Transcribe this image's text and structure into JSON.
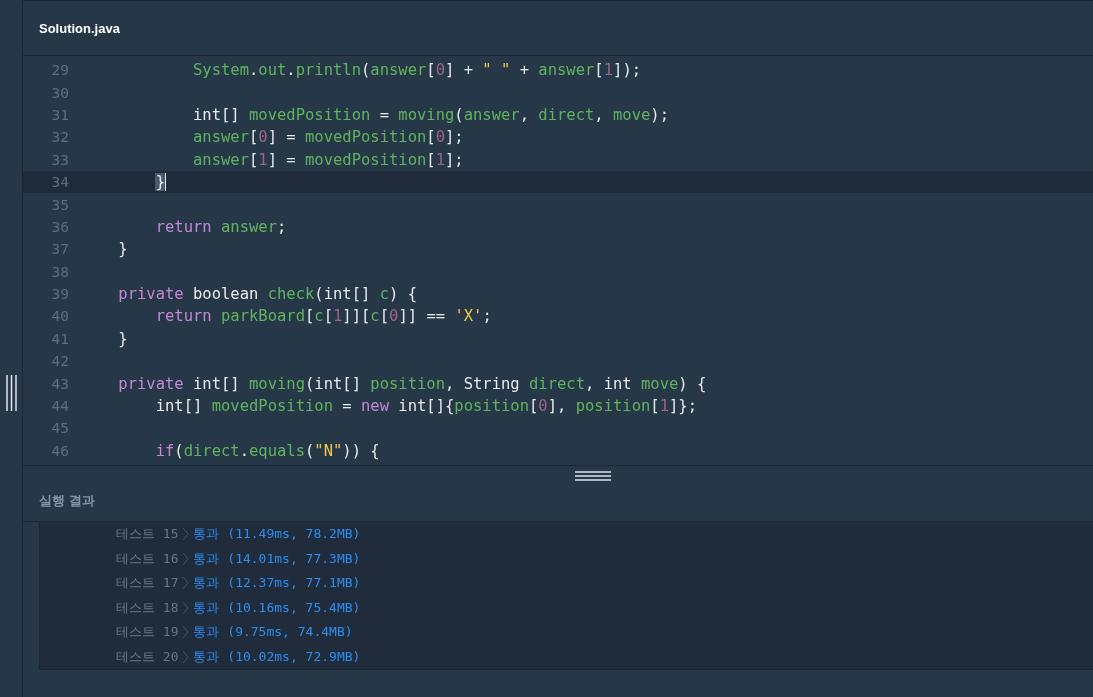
{
  "editor": {
    "file_tab": "Solution.java",
    "lines": [
      {
        "number": "29",
        "current": false,
        "tokens": [
          {
            "kind": "variable",
            "text": "            System"
          },
          {
            "kind": "plain",
            "text": "."
          },
          {
            "kind": "variable",
            "text": "out"
          },
          {
            "kind": "plain",
            "text": "."
          },
          {
            "kind": "variable",
            "text": "println"
          },
          {
            "kind": "plain",
            "text": "("
          },
          {
            "kind": "variable",
            "text": "answer"
          },
          {
            "kind": "plain",
            "text": "["
          },
          {
            "kind": "number",
            "text": "0"
          },
          {
            "kind": "plain",
            "text": "] + "
          },
          {
            "kind": "string",
            "text": "\" \""
          },
          {
            "kind": "plain",
            "text": " + "
          },
          {
            "kind": "variable",
            "text": "answer"
          },
          {
            "kind": "plain",
            "text": "["
          },
          {
            "kind": "number",
            "text": "1"
          },
          {
            "kind": "plain",
            "text": "]);"
          }
        ]
      },
      {
        "number": "30",
        "current": false
      },
      {
        "number": "31",
        "current": false,
        "tokens": [
          {
            "kind": "plain",
            "text": "            int[] "
          },
          {
            "kind": "variable",
            "text": "movedPosition"
          },
          {
            "kind": "plain",
            "text": " = "
          },
          {
            "kind": "variable",
            "text": "moving"
          },
          {
            "kind": "plain",
            "text": "("
          },
          {
            "kind": "variable",
            "text": "answer"
          },
          {
            "kind": "plain",
            "text": ", "
          },
          {
            "kind": "variable",
            "text": "direct"
          },
          {
            "kind": "plain",
            "text": ", "
          },
          {
            "kind": "variable",
            "text": "move"
          },
          {
            "kind": "plain",
            "text": ");"
          }
        ]
      },
      {
        "number": "32",
        "current": false,
        "tokens": [
          {
            "kind": "variable",
            "text": "            answer"
          },
          {
            "kind": "plain",
            "text": "["
          },
          {
            "kind": "number",
            "text": "0"
          },
          {
            "kind": "plain",
            "text": "] = "
          },
          {
            "kind": "variable",
            "text": "movedPosition"
          },
          {
            "kind": "plain",
            "text": "["
          },
          {
            "kind": "number",
            "text": "0"
          },
          {
            "kind": "plain",
            "text": "];"
          }
        ]
      },
      {
        "number": "33",
        "current": false,
        "tokens": [
          {
            "kind": "variable",
            "text": "            answer"
          },
          {
            "kind": "plain",
            "text": "["
          },
          {
            "kind": "number",
            "text": "1"
          },
          {
            "kind": "plain",
            "text": "] = "
          },
          {
            "kind": "variable",
            "text": "movedPosition"
          },
          {
            "kind": "plain",
            "text": "["
          },
          {
            "kind": "number",
            "text": "1"
          },
          {
            "kind": "plain",
            "text": "];"
          }
        ]
      },
      {
        "number": "34",
        "current": true,
        "tokens": [
          {
            "kind": "match",
            "text": "        }"
          }
        ]
      },
      {
        "number": "35",
        "current": false
      },
      {
        "number": "36",
        "current": false,
        "tokens": [
          {
            "kind": "keyword",
            "text": "        return "
          },
          {
            "kind": "variable",
            "text": "answer"
          },
          {
            "kind": "plain",
            "text": ";"
          }
        ]
      },
      {
        "number": "37",
        "current": false,
        "tokens": [
          {
            "kind": "plain",
            "text": "    }"
          }
        ]
      },
      {
        "number": "38",
        "current": false
      },
      {
        "number": "39",
        "current": false,
        "tokens": [
          {
            "kind": "keyword",
            "text": "    private"
          },
          {
            "kind": "plain",
            "text": " boolean "
          },
          {
            "kind": "variable",
            "text": "check"
          },
          {
            "kind": "plain",
            "text": "(int[] "
          },
          {
            "kind": "variable",
            "text": "c"
          },
          {
            "kind": "plain",
            "text": ") {"
          }
        ]
      },
      {
        "number": "40",
        "current": false,
        "tokens": [
          {
            "kind": "keyword",
            "text": "        return "
          },
          {
            "kind": "variable",
            "text": "parkBoard"
          },
          {
            "kind": "plain",
            "text": "["
          },
          {
            "kind": "variable",
            "text": "c"
          },
          {
            "kind": "plain",
            "text": "["
          },
          {
            "kind": "number",
            "text": "1"
          },
          {
            "kind": "plain",
            "text": "]]["
          },
          {
            "kind": "variable",
            "text": "c"
          },
          {
            "kind": "plain",
            "text": "["
          },
          {
            "kind": "number",
            "text": "0"
          },
          {
            "kind": "plain",
            "text": "]] == "
          },
          {
            "kind": "string",
            "text": "'X'"
          },
          {
            "kind": "plain",
            "text": ";"
          }
        ]
      },
      {
        "number": "41",
        "current": false,
        "tokens": [
          {
            "kind": "plain",
            "text": "    }"
          }
        ]
      },
      {
        "number": "42",
        "current": false
      },
      {
        "number": "43",
        "current": false,
        "tokens": [
          {
            "kind": "keyword",
            "text": "    private"
          },
          {
            "kind": "plain",
            "text": " int[] "
          },
          {
            "kind": "variable",
            "text": "moving"
          },
          {
            "kind": "plain",
            "text": "(int[] "
          },
          {
            "kind": "variable",
            "text": "position"
          },
          {
            "kind": "plain",
            "text": ", String "
          },
          {
            "kind": "variable",
            "text": "direct"
          },
          {
            "kind": "plain",
            "text": ", int "
          },
          {
            "kind": "variable",
            "text": "move"
          },
          {
            "kind": "plain",
            "text": ") {"
          }
        ]
      },
      {
        "number": "44",
        "current": false,
        "tokens": [
          {
            "kind": "plain",
            "text": "        int[] "
          },
          {
            "kind": "variable",
            "text": "movedPosition"
          },
          {
            "kind": "plain",
            "text": " = "
          },
          {
            "kind": "keyword",
            "text": "new"
          },
          {
            "kind": "plain",
            "text": " int[]{"
          },
          {
            "kind": "variable",
            "text": "position"
          },
          {
            "kind": "plain",
            "text": "["
          },
          {
            "kind": "number",
            "text": "0"
          },
          {
            "kind": "plain",
            "text": "], "
          },
          {
            "kind": "variable",
            "text": "position"
          },
          {
            "kind": "plain",
            "text": "["
          },
          {
            "kind": "number",
            "text": "1"
          },
          {
            "kind": "plain",
            "text": "]};"
          }
        ]
      },
      {
        "number": "45",
        "current": false
      },
      {
        "number": "46",
        "current": false,
        "tokens": [
          {
            "kind": "keyword",
            "text": "        if"
          },
          {
            "kind": "plain",
            "text": "("
          },
          {
            "kind": "variable",
            "text": "direct"
          },
          {
            "kind": "plain",
            "text": "."
          },
          {
            "kind": "variable",
            "text": "equals"
          },
          {
            "kind": "plain",
            "text": "("
          },
          {
            "kind": "string",
            "text": "\"N\""
          },
          {
            "kind": "plain",
            "text": ")) {"
          }
        ]
      }
    ]
  },
  "results": {
    "title": "실행 결과",
    "rows": [
      {
        "label": "테스트 15",
        "result": "통과 (11.49ms, 78.2MB)"
      },
      {
        "label": "테스트 16",
        "result": "통과 (14.01ms, 77.3MB)"
      },
      {
        "label": "테스트 17",
        "result": "통과 (12.37ms, 77.1MB)"
      },
      {
        "label": "테스트 18",
        "result": "통과 (10.16ms, 75.4MB)"
      },
      {
        "label": "테스트 19",
        "result": "통과 (9.75ms, 74.4MB)"
      },
      {
        "label": "테스트 20",
        "result": "통과 (10.02ms, 72.9MB)"
      }
    ]
  }
}
